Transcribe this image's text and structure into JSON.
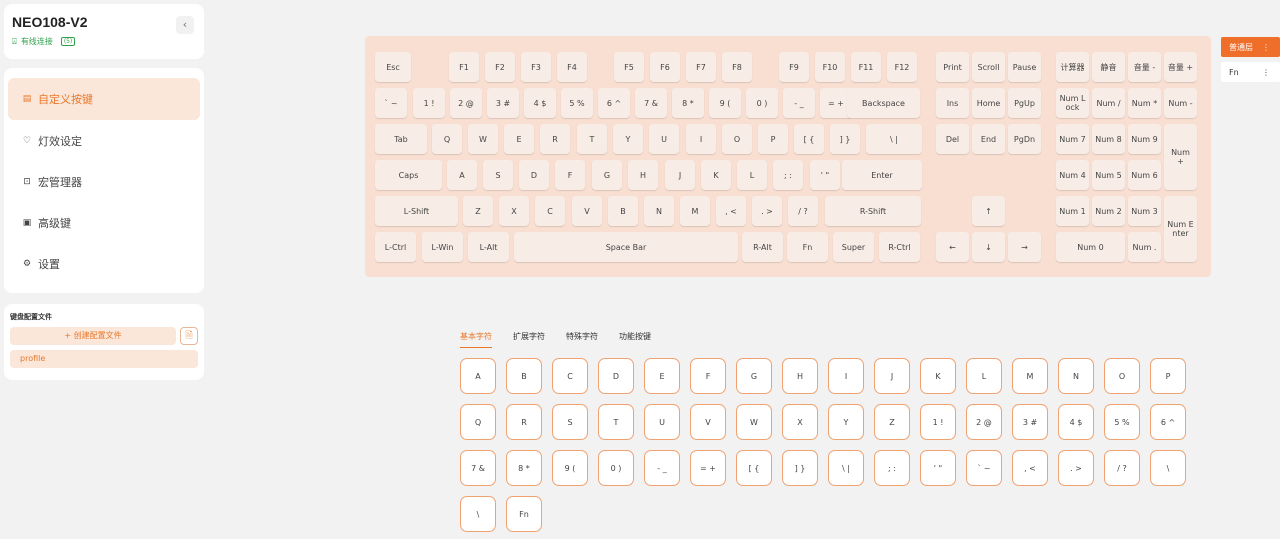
{
  "device": {
    "name": "NEO108-V2",
    "collapse_icon": "‹",
    "conn_status": "有线连接",
    "conn_badge": "(5)"
  },
  "menu": {
    "items": [
      {
        "id": "custom-keys",
        "label": "自定义按键",
        "icon": "▤",
        "active": true
      },
      {
        "id": "lighting",
        "label": "灯效设定",
        "icon": "♡"
      },
      {
        "id": "macro",
        "label": "宏管理器",
        "icon": "⊡"
      },
      {
        "id": "advanced",
        "label": "高级键",
        "icon": "▣"
      },
      {
        "id": "settings",
        "label": "设置",
        "icon": "⚙"
      }
    ]
  },
  "profiles": {
    "title": "键盘配置文件",
    "create_label": "+ 创建配置文件",
    "import_icon": "🗎",
    "items": [
      "profile"
    ]
  },
  "layers": {
    "active": "普通层",
    "fn": "Fn",
    "menu_icon": "⋮"
  },
  "keyboard": {
    "keys": [
      [
        "Esc",
        "F1",
        "F2",
        "F3",
        "F4",
        "F5",
        "F6",
        "F7",
        "F8",
        "F9",
        "F10",
        "F11",
        "F12",
        "Print",
        "Scroll",
        "Pause",
        "计算器",
        "静音",
        "音量 -",
        "音量 +"
      ],
      [
        "` ~",
        "1 !",
        "2 @",
        "3 #",
        "4 $",
        "5 %",
        "6 ^",
        "7 &",
        "8 *",
        "9 (",
        "0 )",
        "- _",
        "= +",
        "Backspace",
        "Ins",
        "Home",
        "PgUp",
        "Num L\nock",
        "Num /",
        "Num *",
        "Num -"
      ],
      [
        "Tab",
        "Q",
        "W",
        "E",
        "R",
        "T",
        "Y",
        "U",
        "I",
        "O",
        "P",
        "[ {",
        "] }",
        "\\ |",
        "Del",
        "End",
        "PgDn",
        "Num 7",
        "Num 8",
        "Num 9",
        "Num\n+"
      ],
      [
        "Caps",
        "A",
        "S",
        "D",
        "F",
        "G",
        "H",
        "J",
        "K",
        "L",
        "; :",
        "' \"",
        "Enter",
        "Num 4",
        "Num 5",
        "Num 6"
      ],
      [
        "L-Shift",
        "Z",
        "X",
        "C",
        "V",
        "B",
        "N",
        "M",
        ", <",
        ". >",
        "/ ?",
        "R-Shift",
        "↑",
        "Num 1",
        "Num 2",
        "Num 3",
        "Num E\nnter"
      ],
      [
        "L-Ctrl",
        "L-Win",
        "L-Alt",
        "Space Bar",
        "R-Alt",
        "Fn",
        "Super",
        "R-Ctrl",
        "←",
        "↓",
        "→",
        "Num 0",
        "Num ."
      ]
    ]
  },
  "picker": {
    "tabs": [
      "基本字符",
      "扩展字符",
      "特殊字符",
      "功能按键"
    ],
    "active_tab": 0,
    "keys": [
      [
        "A",
        "B",
        "C",
        "D",
        "E",
        "F",
        "G",
        "H",
        "I",
        "J",
        "K",
        "L",
        "M",
        "N",
        "O",
        "P"
      ],
      [
        "Q",
        "R",
        "S",
        "T",
        "U",
        "V",
        "W",
        "X",
        "Y",
        "Z",
        "1 !",
        "2 @",
        "3 #",
        "4 $",
        "5 %",
        "6 ^"
      ],
      [
        "7 &",
        "8 *",
        "9 (",
        "0 )",
        "- _",
        "= +",
        "[ {",
        "] }",
        "\\ |",
        "; :",
        "' \"",
        "` ~",
        ", <",
        ". >",
        "/ ?",
        "\\"
      ],
      [
        "\\",
        "Fn"
      ]
    ]
  }
}
